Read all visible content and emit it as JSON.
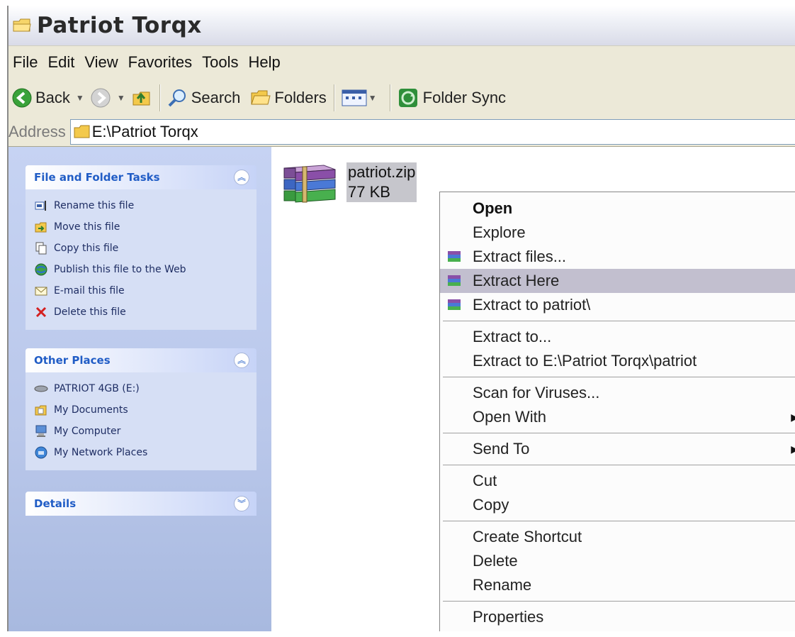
{
  "window": {
    "title": "Patriot Torqx"
  },
  "menubar": [
    "File",
    "Edit",
    "View",
    "Favorites",
    "Tools",
    "Help"
  ],
  "toolbar": {
    "back_label": "Back",
    "search_label": "Search",
    "folders_label": "Folders",
    "folder_sync_label": "Folder Sync"
  },
  "address": {
    "label": "Address",
    "value": "E:\\Patriot Torqx"
  },
  "tasks_panel": {
    "title": "File and Folder Tasks",
    "items": [
      "Rename this file",
      "Move this file",
      "Copy this file",
      "Publish this file to the Web",
      "E-mail this file",
      "Delete this file"
    ]
  },
  "places_panel": {
    "title": "Other Places",
    "items": [
      "PATRIOT 4GB (E:)",
      "My Documents",
      "My Computer",
      "My Network Places"
    ]
  },
  "details_panel": {
    "title": "Details"
  },
  "file": {
    "name": "patriot.zip",
    "size": "77 KB"
  },
  "context_menu": {
    "open": "Open",
    "explore": "Explore",
    "extract_files": "Extract files...",
    "extract_here": "Extract Here",
    "extract_to_patriot": "Extract to patriot\\",
    "extract_to": "Extract to...",
    "extract_to_path": "Extract to E:\\Patriot Torqx\\patriot",
    "scan": "Scan for Viruses...",
    "open_with": "Open With",
    "send_to": "Send To",
    "cut": "Cut",
    "copy": "Copy",
    "create_shortcut": "Create Shortcut",
    "delete": "Delete",
    "rename": "Rename",
    "properties": "Properties"
  }
}
